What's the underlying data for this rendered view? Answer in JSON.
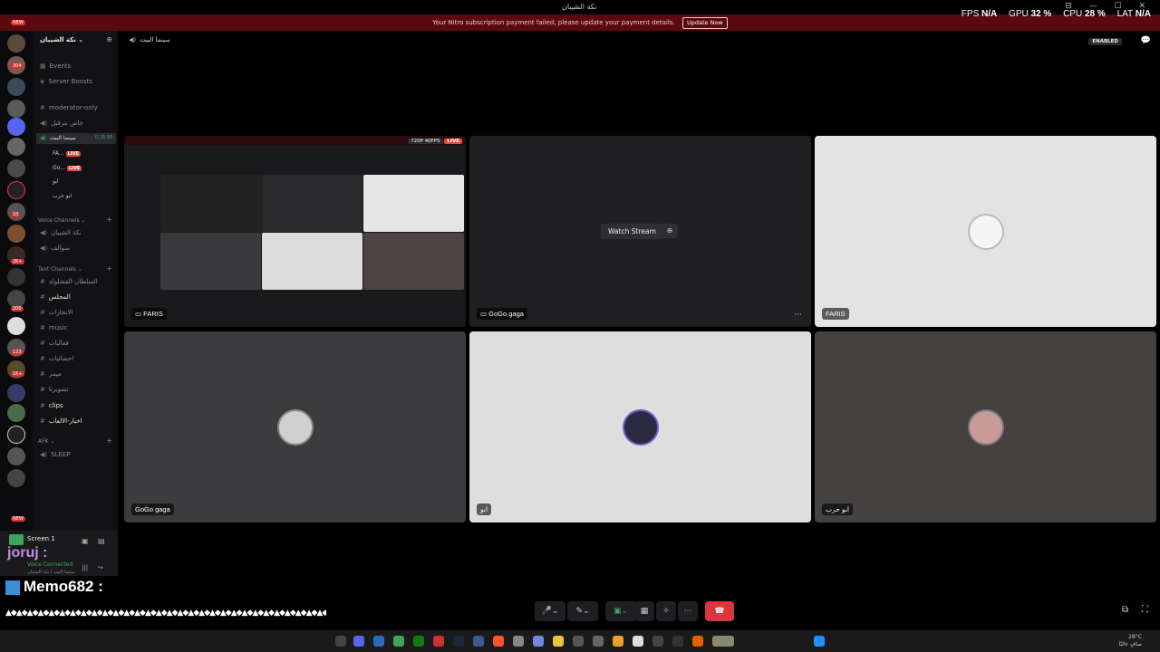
{
  "window": {
    "title": "نكة الشيبان",
    "controls": "⊟ — ☐ ✕"
  },
  "nitro_banner": {
    "message": "Your Nitro subscription payment failed, please update your payment details.",
    "button": "Update Now"
  },
  "perf": {
    "fps_label": "FPS",
    "fps_value": "N/A",
    "gpu_label": "GPU",
    "gpu_value": "32 %",
    "cpu_label": "CPU",
    "cpu_value": "28 %",
    "lat_label": "LAT",
    "lat_value": "N/A"
  },
  "servers": {
    "badges": [
      "NEW",
      "304",
      "10",
      "2K+",
      "200",
      "123",
      "1K+",
      "NEW"
    ]
  },
  "sidebar": {
    "guild_name": "نكة الشيبان",
    "events": "Events",
    "server_boosts": "Server Boosts",
    "channels_top": [
      "moderator-only",
      "خاص بترقيل"
    ],
    "active_voice": {
      "name": "سينما البيت",
      "timer": "0:18:58"
    },
    "voice_users": [
      {
        "name": "FA...",
        "live": "LIVE"
      },
      {
        "name": "Go...",
        "live": "LIVE"
      },
      {
        "name": "ابو"
      },
      {
        "name": "ابو حرب"
      }
    ],
    "voice_category": "Voice Channels",
    "voice_channels": [
      "نكة الشيبان",
      "سوالف"
    ],
    "text_category": "Text Channels",
    "text_channels": [
      "السلطان-الفشلولة",
      "المجلس",
      "الانجازات",
      "music",
      "فعاليات",
      "احصائيات",
      "ميمز",
      "تصويرنا",
      "clips",
      "اخبار-الالعاب"
    ],
    "afk_category": "AFK",
    "afk_channels": [
      "SLEEP"
    ]
  },
  "user_panel": {
    "screen_label": "Screen 1",
    "username": "joruj",
    "username_suffix": ":",
    "status": "Voice Connected",
    "channel": "سينما البيت / نكة الشيبان"
  },
  "overlay": {
    "memo": "Memo682 :"
  },
  "header": {
    "channel_name": "سينما البيت",
    "enabled_label": "ENABLED"
  },
  "tiles": {
    "stream_preview": {
      "name": "FARIS",
      "quality": "720P 40FPS",
      "live": "LIVE"
    },
    "gogo_stream": {
      "name": "GoGo gaga",
      "watch": "Watch Stream"
    },
    "faris": {
      "name": "FARIS"
    },
    "gogo_user": {
      "name": "GoGo gaga"
    },
    "abu_user": {
      "name": "ابو"
    },
    "abu_harb": {
      "name": "ابو حرب"
    }
  },
  "taskbar": {
    "weather": "28°C",
    "tray_text": "صافٍ غالبًا"
  },
  "colors": {
    "accent_red": "#ed4245",
    "accent_green": "#3ba55d",
    "nitro_bar": "#5a0a0f"
  }
}
